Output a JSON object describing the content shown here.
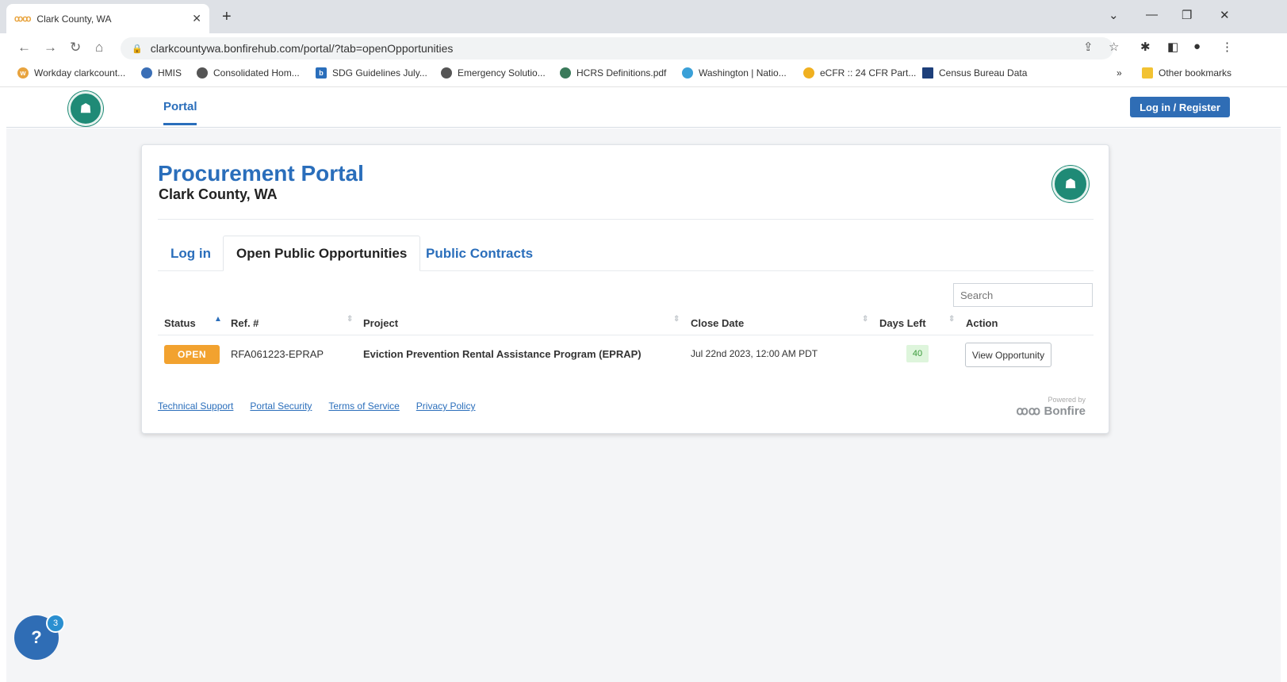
{
  "browser": {
    "tab_title": "Clark County, WA",
    "url": "clarkcountywa.bonfirehub.com/portal/?tab=openOpportunities",
    "bookmarks": [
      "Workday clarkcount...",
      "HMIS",
      "Consolidated Hom...",
      "SDG Guidelines July...",
      "Emergency Solutio...",
      "HCRS Definitions.pdf",
      "Washington | Natio...",
      "eCFR :: 24 CFR Part...",
      "Census Bureau Data"
    ],
    "other_bookmarks": "Other bookmarks"
  },
  "header": {
    "portal_label": "Portal",
    "login_register": "Log in / Register"
  },
  "card": {
    "title": "Procurement Portal",
    "subtitle": "Clark County, WA",
    "tabs": [
      "Log in",
      "Open Public Opportunities",
      "Public Contracts"
    ],
    "search_placeholder": "Search",
    "columns": [
      "Status",
      "Ref. #",
      "Project",
      "Close Date",
      "Days Left",
      "Action"
    ],
    "rows": [
      {
        "status": "OPEN",
        "ref": "RFA061223-EPRAP",
        "project": "Eviction Prevention Rental Assistance Program (EPRAP)",
        "close_date": "Jul 22nd 2023, 12:00 AM PDT",
        "days_left": "40",
        "action": "View Opportunity"
      }
    ],
    "footer_links": [
      "Technical Support",
      "Portal Security",
      "Terms of Service",
      "Privacy Policy"
    ],
    "powered_by": "Powered by",
    "brand": "Bonfire"
  },
  "help": {
    "label": "?",
    "badge": "3"
  },
  "colors": {
    "accent": "#2a6ebb",
    "open_badge": "#f2a22f",
    "days_bg": "#def5dc"
  }
}
